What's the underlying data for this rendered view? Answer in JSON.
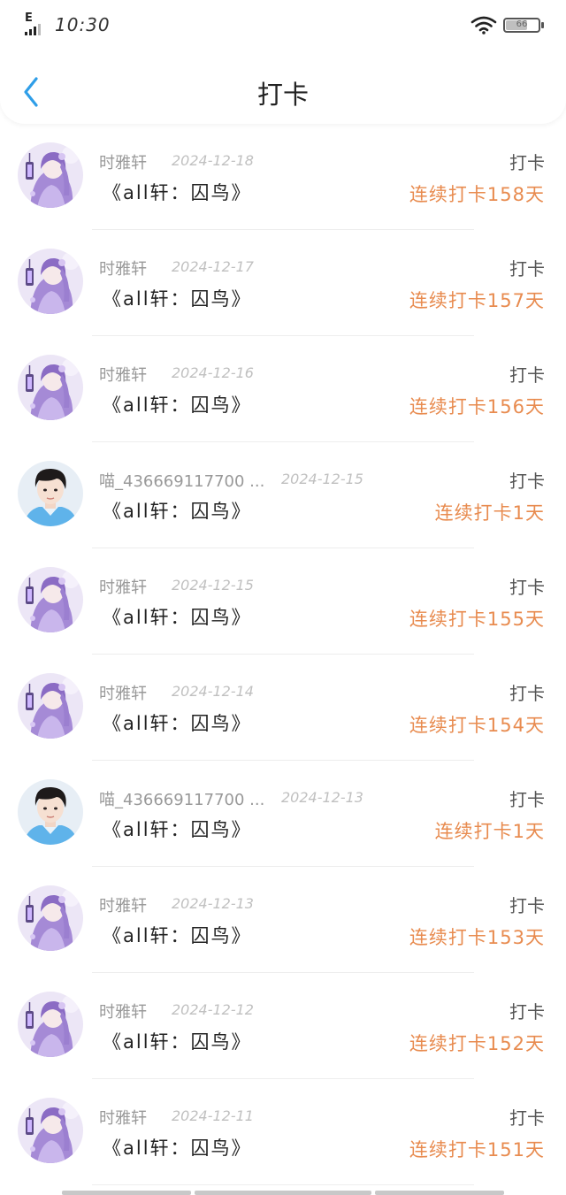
{
  "status_bar": {
    "network": "E",
    "time": "10:30",
    "battery": "66",
    "battery_level": 0.66
  },
  "nav": {
    "title": "打卡",
    "back_icon": "chevron-left-icon"
  },
  "colors": {
    "accent_blue": "#2f9ee8",
    "streak_orange": "#e88b4f"
  },
  "entries": [
    {
      "name": "时雅轩",
      "date": "2024-12-18",
      "book": "《all轩：囚鸟》",
      "tag": "打卡",
      "streak": "连续打卡158天",
      "avatar": "purple"
    },
    {
      "name": "时雅轩",
      "date": "2024-12-17",
      "book": "《all轩：囚鸟》",
      "tag": "打卡",
      "streak": "连续打卡157天",
      "avatar": "purple"
    },
    {
      "name": "时雅轩",
      "date": "2024-12-16",
      "book": "《all轩：囚鸟》",
      "tag": "打卡",
      "streak": "连续打卡156天",
      "avatar": "purple"
    },
    {
      "name": "喵_436669117700 ...",
      "date": "2024-12-15",
      "book": "《all轩：囚鸟》",
      "tag": "打卡",
      "streak": "连续打卡1天",
      "avatar": "boy"
    },
    {
      "name": "时雅轩",
      "date": "2024-12-15",
      "book": "《all轩：囚鸟》",
      "tag": "打卡",
      "streak": "连续打卡155天",
      "avatar": "purple"
    },
    {
      "name": "时雅轩",
      "date": "2024-12-14",
      "book": "《all轩：囚鸟》",
      "tag": "打卡",
      "streak": "连续打卡154天",
      "avatar": "purple"
    },
    {
      "name": "喵_436669117700 ...",
      "date": "2024-12-13",
      "book": "《all轩：囚鸟》",
      "tag": "打卡",
      "streak": "连续打卡1天",
      "avatar": "boy"
    },
    {
      "name": "时雅轩",
      "date": "2024-12-13",
      "book": "《all轩：囚鸟》",
      "tag": "打卡",
      "streak": "连续打卡153天",
      "avatar": "purple"
    },
    {
      "name": "时雅轩",
      "date": "2024-12-12",
      "book": "《all轩：囚鸟》",
      "tag": "打卡",
      "streak": "连续打卡152天",
      "avatar": "purple"
    },
    {
      "name": "时雅轩",
      "date": "2024-12-11",
      "book": "《all轩：囚鸟》",
      "tag": "打卡",
      "streak": "连续打卡151天",
      "avatar": "purple"
    }
  ]
}
